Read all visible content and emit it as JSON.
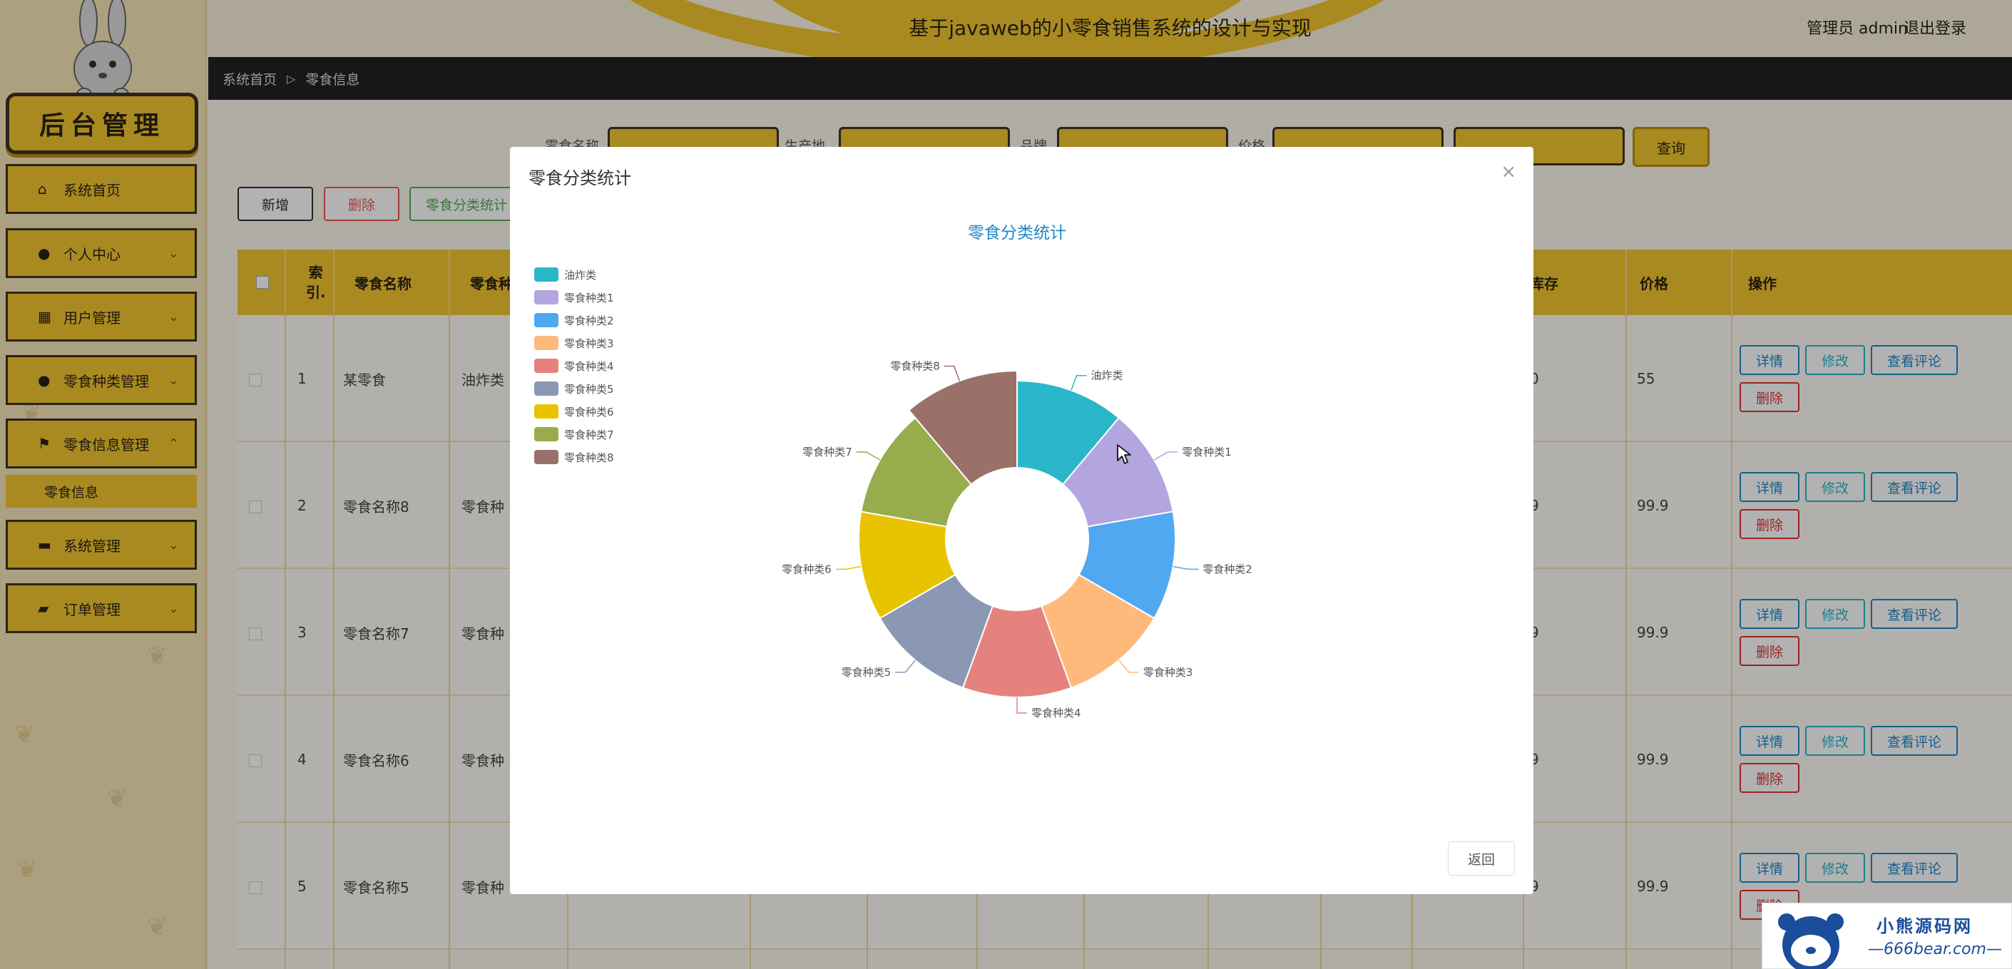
{
  "header": {
    "system_title": "基于javaweb的小零食销售系统的设计与实现",
    "admin_label": "管理员 admin",
    "logout_label": "退出登录"
  },
  "sidebar": {
    "logo_text": "后台管理",
    "items": [
      {
        "label": "系统首页",
        "icon": "home-icon"
      },
      {
        "label": "个人中心",
        "icon": "user-icon"
      },
      {
        "label": "用户管理",
        "icon": "grid-icon"
      },
      {
        "label": "零食种类管理",
        "icon": "user-icon"
      },
      {
        "label": "零食信息管理",
        "icon": "flag-icon"
      },
      {
        "label": "系统管理",
        "icon": "chat-icon"
      },
      {
        "label": "订单管理",
        "icon": "ticket-icon"
      }
    ],
    "submenu_active": "零食信息"
  },
  "breadcrumb": {
    "home": "系统首页",
    "separator": "▷",
    "current": "零食信息"
  },
  "search": {
    "labels": [
      "零食名称",
      "生产地",
      "品牌",
      "价格"
    ]
  },
  "actions": {
    "add": "新增",
    "delete": "删除",
    "stats": "零食分类统计",
    "query": "查询"
  },
  "table": {
    "headers": [
      "索引",
      "零食名称",
      "零食种",
      "库存",
      "价格",
      "操作"
    ],
    "index_header_lines": [
      "索",
      "引."
    ],
    "rows": [
      {
        "index": "1",
        "name": "某零食",
        "category": "油炸类",
        "stock": "0",
        "price": "55"
      },
      {
        "index": "2",
        "name": "零食名称8",
        "category": "零食种",
        "stock": "9",
        "price": "99.9"
      },
      {
        "index": "3",
        "name": "零食名称7",
        "category": "零食种",
        "stock": "9",
        "price": "99.9"
      },
      {
        "index": "4",
        "name": "零食名称6",
        "category": "零食种",
        "stock": "9",
        "price": "99.9"
      },
      {
        "index": "5",
        "name": "零食名称5",
        "category": "零食种",
        "stock": "9",
        "price": "99.9"
      }
    ],
    "row_buttons": {
      "detail": "详情",
      "edit": "修改",
      "comments": "查看评论",
      "delete": "删除"
    }
  },
  "dialog": {
    "title": "零食分类统计",
    "close": "×",
    "return_label": "返回"
  },
  "chart_data": {
    "type": "pie",
    "title": "零食分类统计",
    "donut": true,
    "legend_position": "top-left",
    "categories": [
      "油炸类",
      "零食种类1",
      "零食种类2",
      "零食种类3",
      "零食种类4",
      "零食种类5",
      "零食种类6",
      "零食种类7",
      "零食种类8"
    ],
    "values": [
      1,
      1,
      1,
      1,
      1,
      1,
      1,
      1,
      1
    ],
    "colors": [
      "#2ab7ca",
      "#b3a5e0",
      "#4fa8f0",
      "#ffb97a",
      "#e6827e",
      "#8a98b4",
      "#e8c300",
      "#98ac4e",
      "#9a7168"
    ]
  },
  "watermark": {
    "line1": "小熊源码网",
    "line2": "—666bear.com—"
  },
  "colors": {
    "accent": "#f2c630",
    "dark": "#3b3324"
  }
}
